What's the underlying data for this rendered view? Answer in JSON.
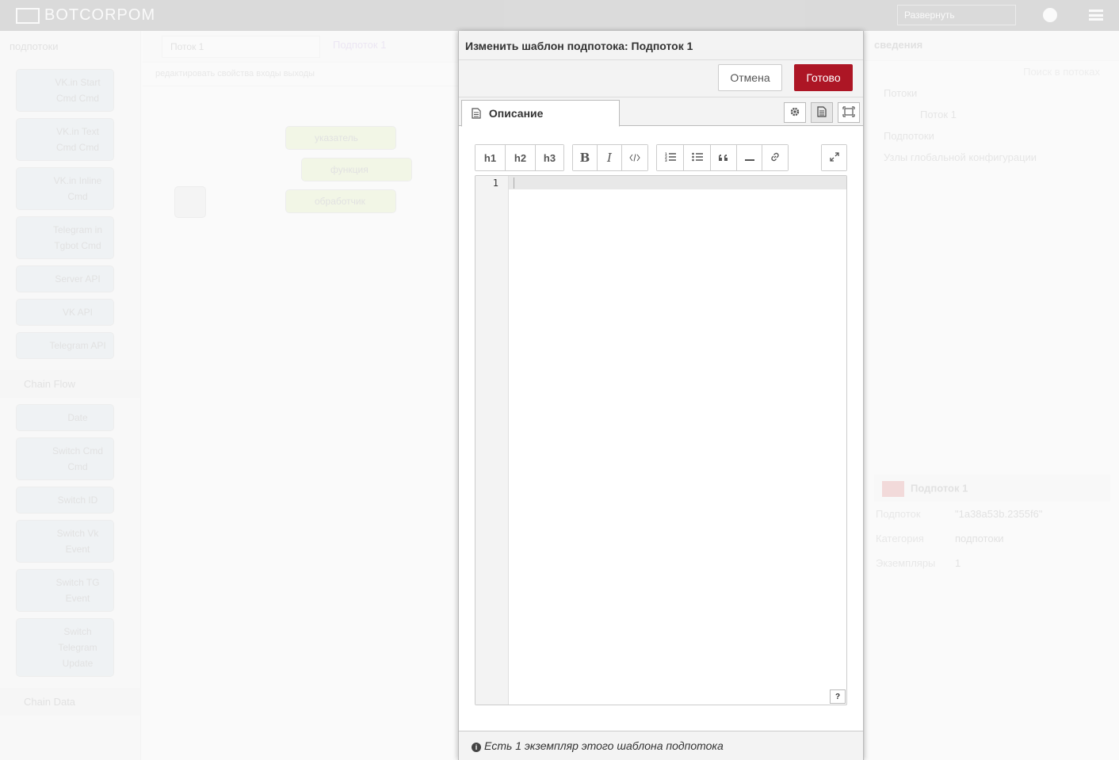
{
  "app": {
    "logo_text": "BOTCORPOM"
  },
  "background": {
    "deploy_label": "Развернуть",
    "palette_header": "подпотоки",
    "palette_nodes": [
      "VK.in Start Cmd Cmd",
      "VK.in Text Cmd Cmd",
      "VK.in Inline Cmd",
      "Telegram in Tgbot Cmd",
      "Server API",
      "VK API",
      "Telegram API"
    ],
    "category_flow": "Chain Flow",
    "flow_nodes": [
      "Date",
      "Switch Cmd Cmd",
      "Switch ID",
      "Switch Vk Event",
      "Switch TG Event",
      "Switch Telegram Update"
    ],
    "category_data": "Chain Data",
    "ws_tab": "Поток 1",
    "ws_tab_subflow": "Подпоток 1",
    "ws_toolbar": "редактировать свойства   входы   выходы",
    "ws_nodes": [
      "указатель",
      "функция",
      "обработчик"
    ],
    "sidebar_title": "сведения",
    "sidebar_search": "Поиск в потоках",
    "sidebar_rows": [
      "Потоки",
      "Поток 1",
      "Подпотоки",
      "Узлы глобальной конфигурации"
    ],
    "info_title": "Подпоток 1",
    "info_props": [
      {
        "k": "Подпоток",
        "v": "\"1a38a53b.2355f6\""
      },
      {
        "k": "Категория",
        "v": "подпотоки"
      },
      {
        "k": "Экземпляры",
        "v": "1"
      }
    ]
  },
  "dialog": {
    "title": "Изменить шаблон подпотока: Подпоток 1",
    "cancel_label": "Отмена",
    "done_label": "Готово",
    "tab_label": "Описание",
    "toolbar": {
      "h1": "h1",
      "h2": "h2",
      "h3": "h3",
      "bold": "B",
      "italic": "I"
    },
    "editor": {
      "line_number": "1",
      "help_label": "?"
    },
    "footer_text": "Есть 1 экземпляр этого шаблона подпотока"
  },
  "colors": {
    "done_button": "#ad1625",
    "topbar": "#000000"
  }
}
